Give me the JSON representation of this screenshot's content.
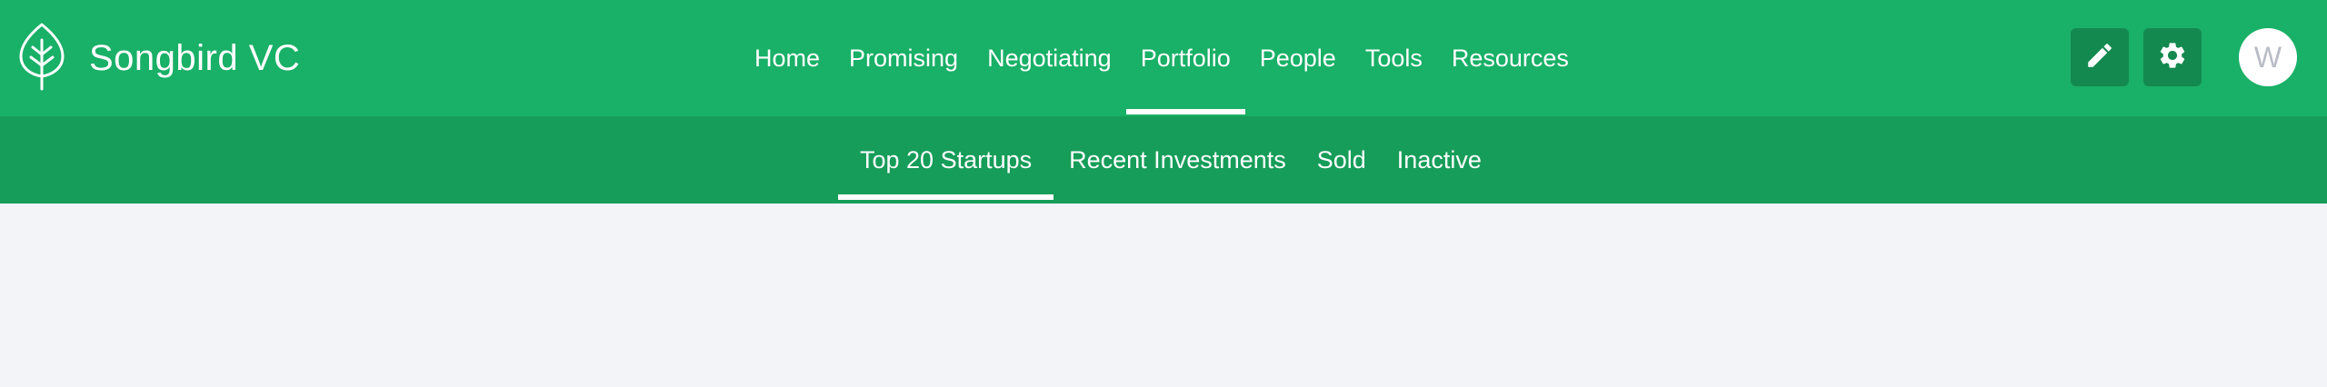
{
  "brand": {
    "name": "Songbird VC",
    "logo_icon": "leaf-icon"
  },
  "main_nav": {
    "items": [
      {
        "label": "Home",
        "active": false
      },
      {
        "label": "Promising",
        "active": false
      },
      {
        "label": "Negotiating",
        "active": false
      },
      {
        "label": "Portfolio",
        "active": true
      },
      {
        "label": "People",
        "active": false
      },
      {
        "label": "Tools",
        "active": false
      },
      {
        "label": "Resources",
        "active": false
      }
    ]
  },
  "actions": {
    "edit_icon": "pencil-icon",
    "settings_icon": "gear-icon",
    "avatar_initial": "W"
  },
  "sub_nav": {
    "items": [
      {
        "label": "Top 20 Startups",
        "active": true
      },
      {
        "label": "Recent Investments",
        "active": false
      },
      {
        "label": "Sold",
        "active": false
      },
      {
        "label": "Inactive",
        "active": false
      }
    ]
  },
  "colors": {
    "topbar": "#19b067",
    "subbar": "#169d59",
    "icon_button": "#14894f",
    "content_bg": "#f3f4f8"
  }
}
